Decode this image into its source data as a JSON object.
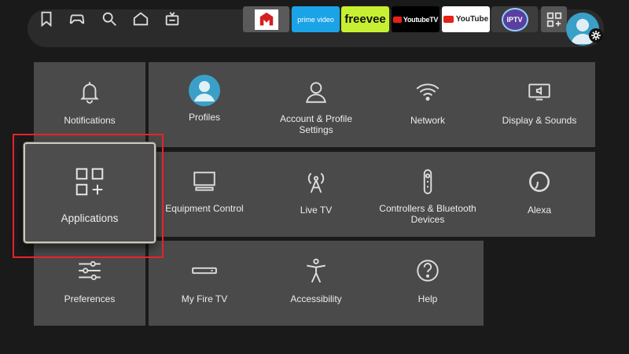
{
  "nav": {
    "icons": [
      "bookmark-icon",
      "gamepad-icon",
      "search-icon",
      "home-icon",
      "live-tv-icon"
    ],
    "apps": [
      {
        "name": "downloader-app"
      },
      {
        "label": "prime video",
        "color": "#1ba3e8"
      },
      {
        "label": "freevee",
        "color": "#c8f032"
      },
      {
        "label": "YoutubeTV",
        "color": "#000000"
      },
      {
        "label": "YouTube",
        "color": "#ffffff"
      },
      {
        "label": "IPTV",
        "color": "#5a3fa0"
      }
    ]
  },
  "settings": {
    "notifications": "Notifications",
    "profiles": "Profiles",
    "account_profile": "Account & Profile Settings",
    "network": "Network",
    "display_sounds": "Display & Sounds",
    "applications": "Applications",
    "equipment_control": "Equipment Control",
    "live_tv": "Live TV",
    "controllers_bluetooth": "Controllers & Bluetooth Devices",
    "alexa": "Alexa",
    "preferences": "Preferences",
    "my_fire_tv": "My Fire TV",
    "accessibility": "Accessibility",
    "help": "Help"
  },
  "colors": {
    "highlight": "#e8232a",
    "tile": "#4a4a4a",
    "accent_avatar": "#3aa0c8"
  }
}
